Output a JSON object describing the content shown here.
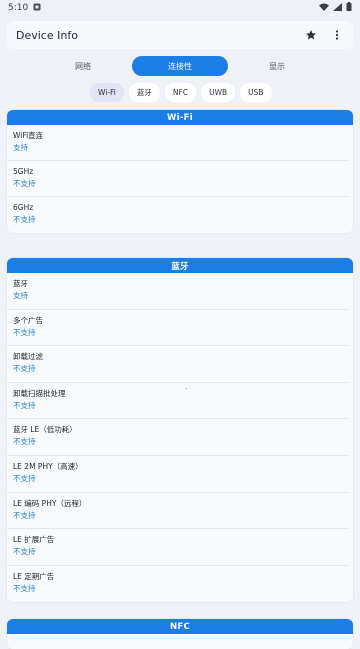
{
  "status_bar": {
    "time": "5:10",
    "icons": [
      "notification-icon",
      "wifi-icon",
      "signal-icon",
      "battery-icon"
    ]
  },
  "app_bar": {
    "title": "Device Info",
    "icons": [
      "star-icon",
      "more-vert-icon"
    ]
  },
  "main_tabs": [
    {
      "label": "网络",
      "active": false
    },
    {
      "label": "连接性",
      "active": true
    },
    {
      "label": "显示",
      "active": false
    }
  ],
  "chips": [
    {
      "label": "Wi-Fi",
      "active": true
    },
    {
      "label": "蓝牙",
      "active": false
    },
    {
      "label": "NFC",
      "active": false
    },
    {
      "label": "UWB",
      "active": false
    },
    {
      "label": "USB",
      "active": false
    }
  ],
  "sections": {
    "wifi": {
      "title": "Wi-Fi",
      "rows": [
        {
          "label": "WiFi直连",
          "value": "支持"
        },
        {
          "label": "5GHz",
          "value": "不支持"
        },
        {
          "label": "6GHz",
          "value": "不支持"
        }
      ]
    },
    "bluetooth": {
      "title": "蓝牙",
      "rows": [
        {
          "label": "蓝牙",
          "value": "支持"
        },
        {
          "label": "多个广告",
          "value": "不支持"
        },
        {
          "label": "卸载过滤",
          "value": "不支持"
        },
        {
          "label": "卸载扫描批处理",
          "value": "不支持"
        },
        {
          "label": "蓝牙 LE（低功耗）",
          "value": "不支持"
        },
        {
          "label": "LE 2M PHY（高速）",
          "value": "不支持"
        },
        {
          "label": "LE 编码 PHY（远程）",
          "value": "不支持"
        },
        {
          "label": "LE 扩展广告",
          "value": "不支持"
        },
        {
          "label": "LE 定期广告",
          "value": "不支持"
        }
      ]
    },
    "nfc": {
      "title": "NFC"
    }
  },
  "colors": {
    "accent": "#1b7de6",
    "value_text": "#2b86d8",
    "background": "#eef1f5",
    "chip_active": "#e3e5f7"
  }
}
